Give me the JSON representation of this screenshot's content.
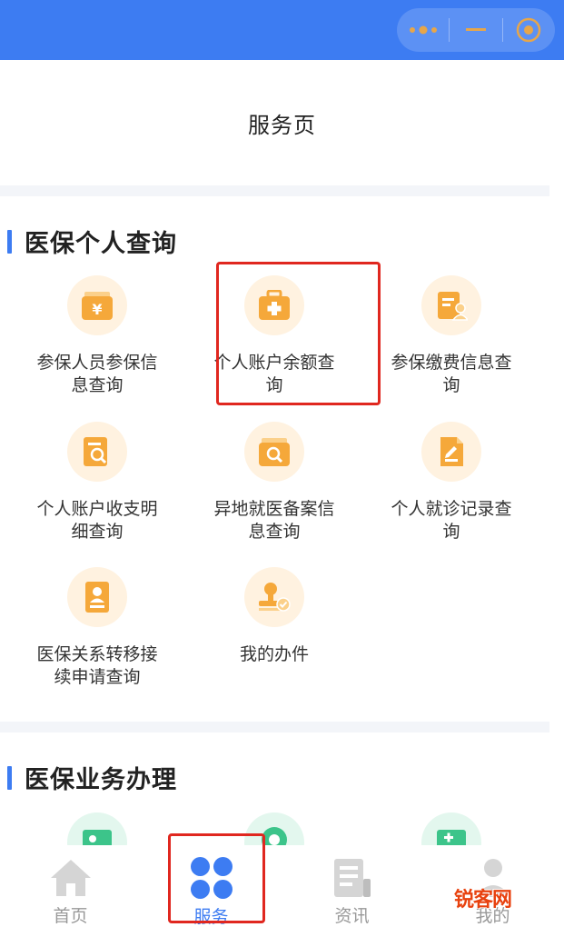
{
  "header": {
    "title": "服务页"
  },
  "sections": [
    {
      "title": "医保个人查询",
      "items": [
        {
          "label": "参保人员参保信息查询",
          "icon": "wallet-yen-icon"
        },
        {
          "label": "个人账户余额查询",
          "icon": "medical-kit-icon",
          "highlighted": true
        },
        {
          "label": "参保缴费信息查询",
          "icon": "payment-record-icon"
        },
        {
          "label": "个人账户收支明细查询",
          "icon": "document-search-icon"
        },
        {
          "label": "异地就医备案信息查询",
          "icon": "folder-search-icon"
        },
        {
          "label": "个人就诊记录查询",
          "icon": "edit-document-icon"
        },
        {
          "label": "医保关系转移接续申请查询",
          "icon": "id-card-icon"
        },
        {
          "label": "我的办件",
          "icon": "stamp-check-icon"
        }
      ]
    },
    {
      "title": "医保业务办理",
      "items": [
        {
          "label": "",
          "icon": "id-card-green-icon"
        },
        {
          "label": "",
          "icon": "circle-green-icon"
        },
        {
          "label": "",
          "icon": "add-card-green-icon"
        }
      ]
    }
  ],
  "tabbar": {
    "items": [
      {
        "label": "首页",
        "icon": "home-icon",
        "active": false
      },
      {
        "label": "服务",
        "icon": "services-grid-icon",
        "active": true
      },
      {
        "label": "资讯",
        "icon": "news-icon",
        "active": false
      },
      {
        "label": "我的",
        "icon": "profile-icon",
        "active": false
      }
    ]
  },
  "watermark": {
    "text": "锐客网"
  },
  "colors": {
    "primary": "#3d7cf2",
    "icon_orange": "#f5a83a",
    "icon_bg": "#fff2e0",
    "highlight": "#e0271f",
    "green": "#3cc48a"
  }
}
